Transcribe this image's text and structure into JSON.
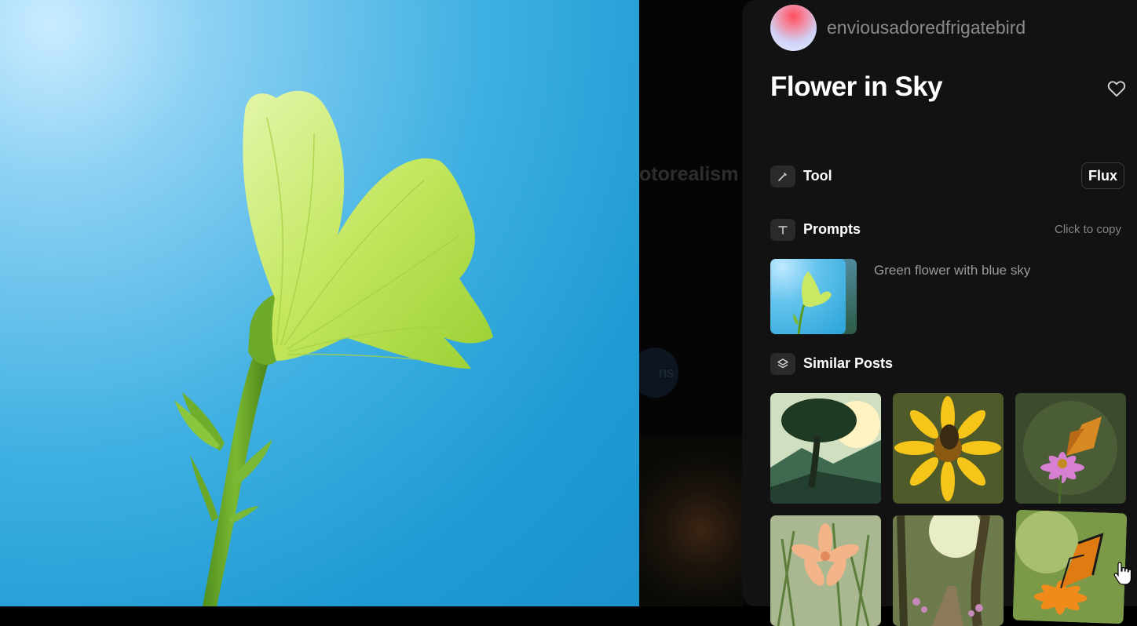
{
  "author": {
    "username": "enviousadoredfrigatebird"
  },
  "post": {
    "title": "Flower in Sky"
  },
  "backdrop": {
    "word": "otorealism",
    "pill_text": "ns"
  },
  "tool": {
    "label": "Tool",
    "value": "Flux"
  },
  "prompts": {
    "label": "Prompts",
    "copy_hint": "Click to copy",
    "text": "Green flower with blue sky"
  },
  "similar": {
    "label": "Similar Posts"
  },
  "colors": {
    "panel": "#121212",
    "accent_sky": "#2aa3d8",
    "muted_text": "#8a8a8a"
  },
  "icons": [
    "heart-icon",
    "brush-icon",
    "text-t-icon",
    "layers-icon",
    "hand-cursor-icon"
  ]
}
